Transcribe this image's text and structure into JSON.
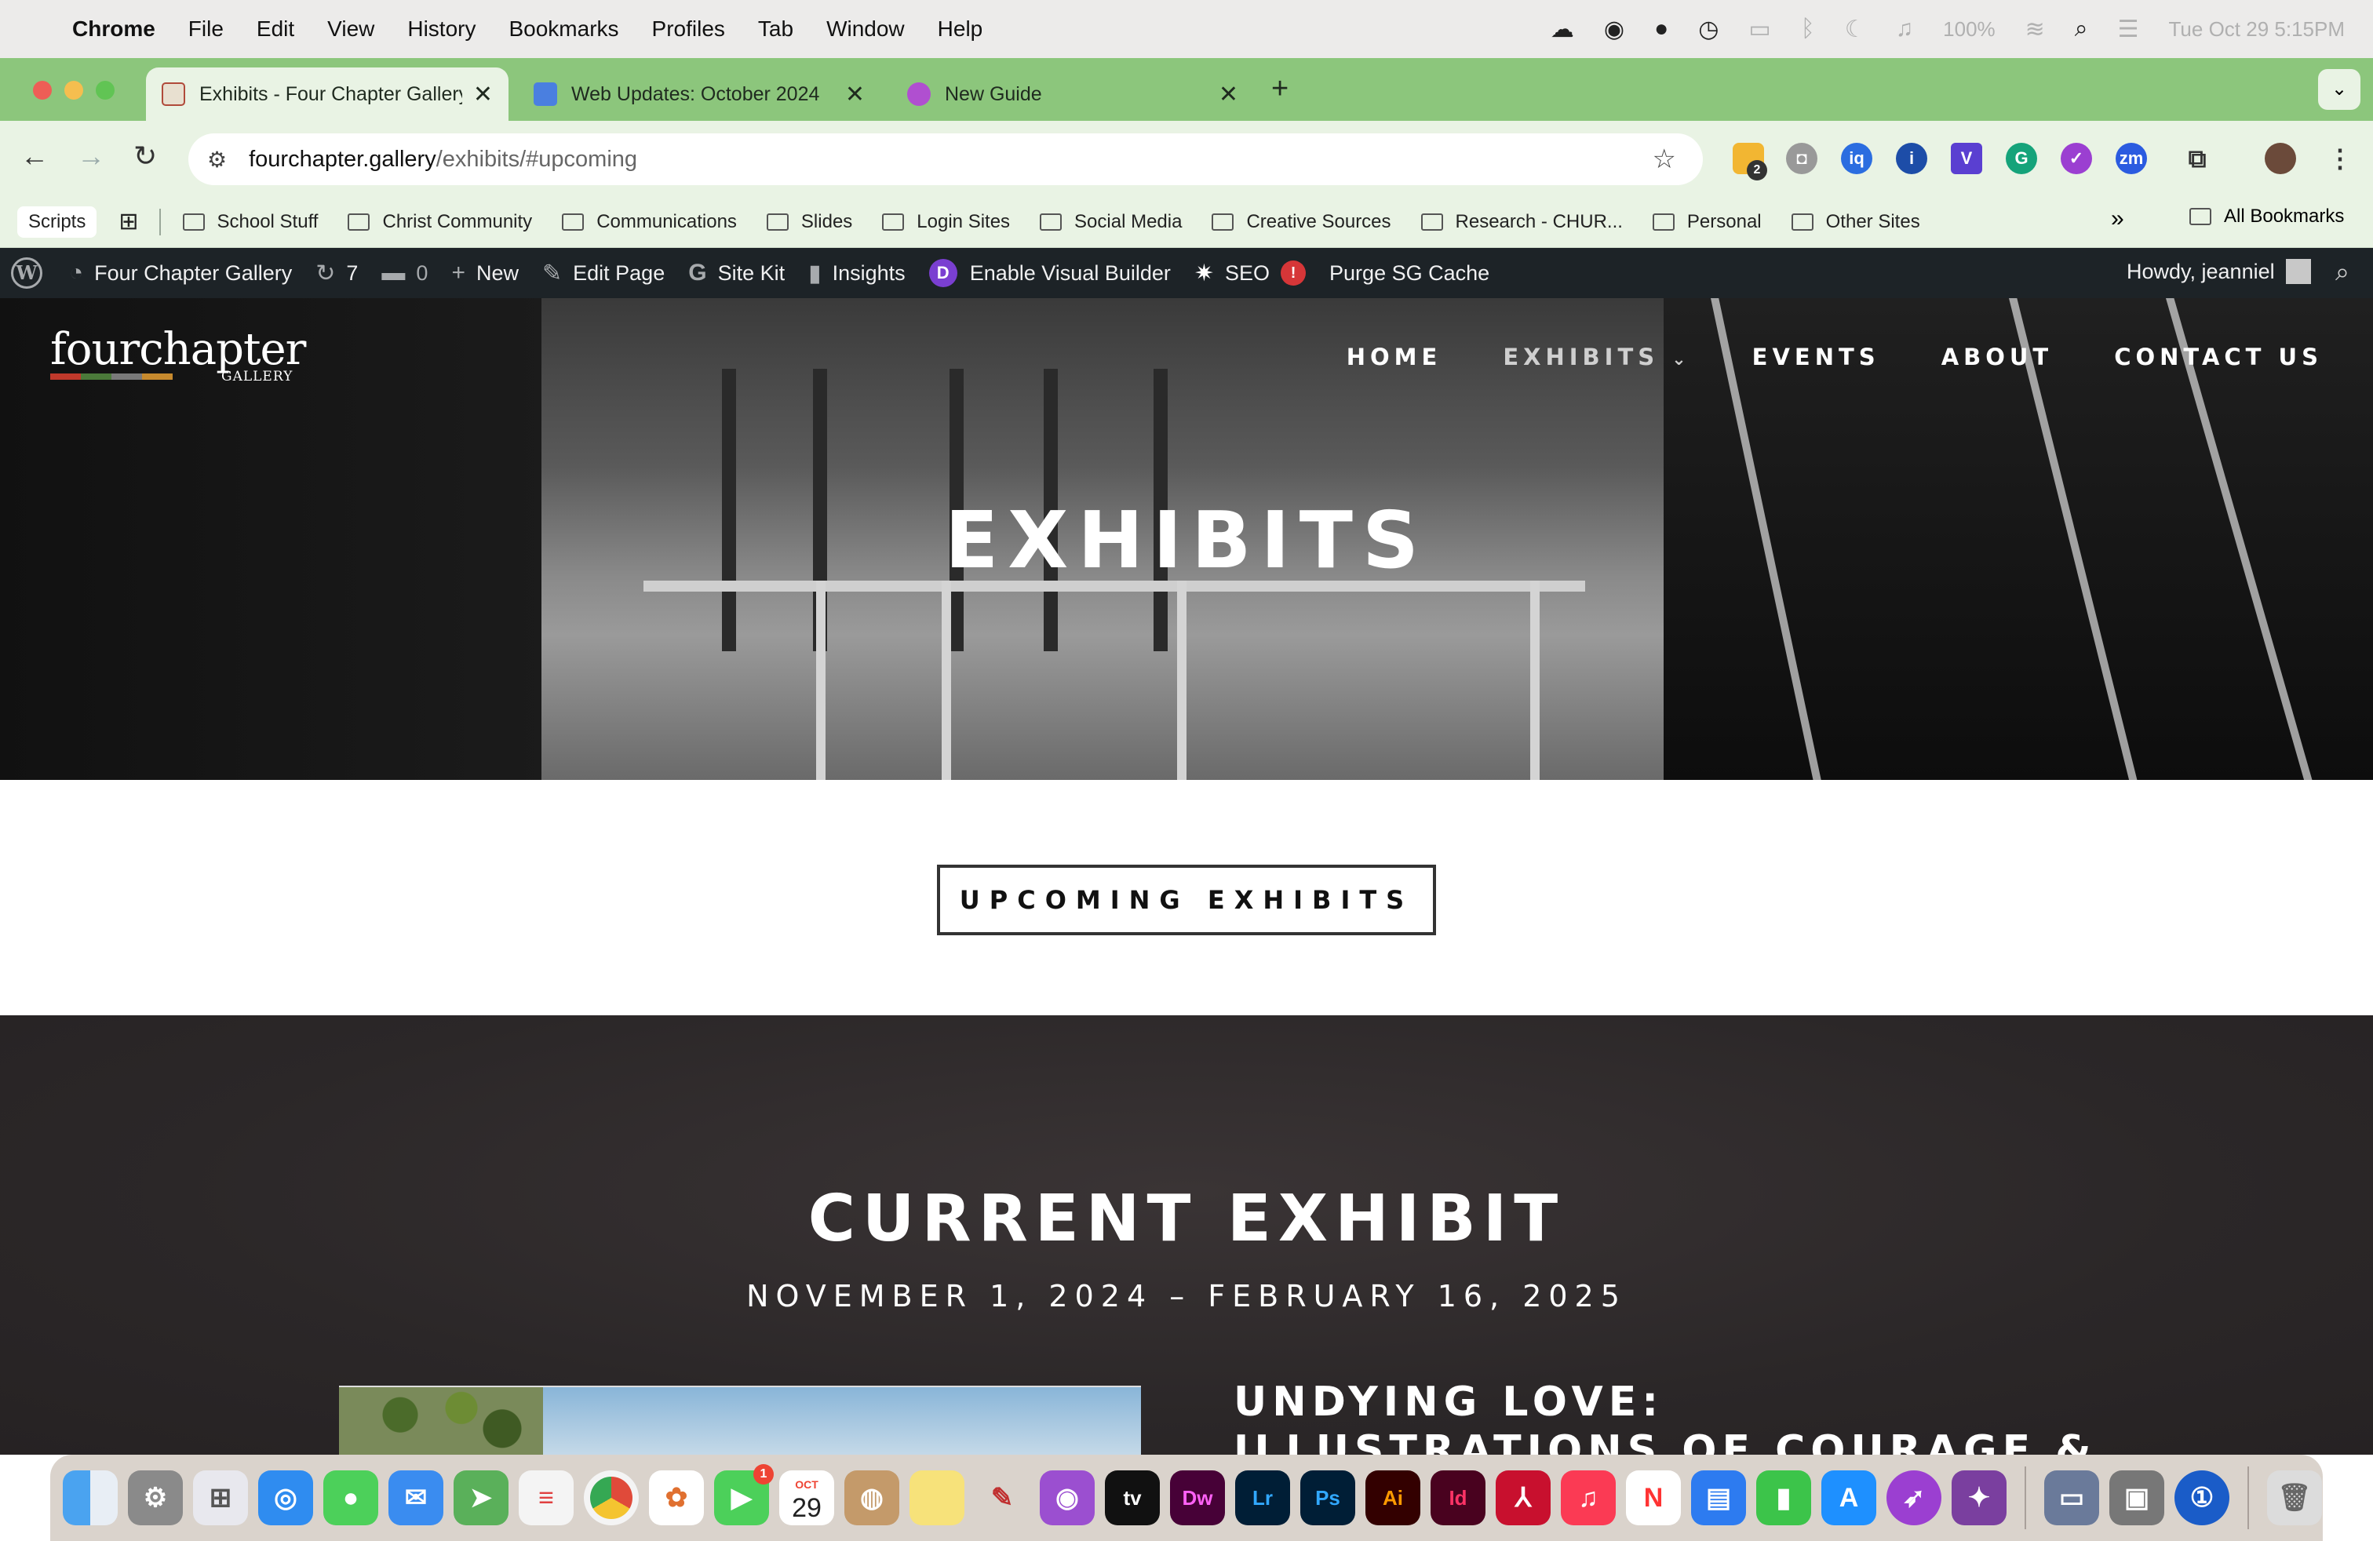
{
  "menubar": {
    "app": "Chrome",
    "items": [
      "File",
      "Edit",
      "View",
      "History",
      "Bookmarks",
      "Profiles",
      "Tab",
      "Window",
      "Help"
    ],
    "battery": "100%",
    "clock": "Tue Oct 29  5:15PM"
  },
  "tabs": [
    {
      "title": "Exhibits - Four Chapter Gallery",
      "active": true
    },
    {
      "title": "Web Updates: October 2024",
      "active": false
    },
    {
      "title": "New Guide",
      "active": false
    }
  ],
  "address": {
    "host": "fourchapter.gallery",
    "path": "/exhibits/#upcoming"
  },
  "extensions": {
    "badge": "2"
  },
  "bookmarks": {
    "scripts": "Scripts",
    "folders": [
      "School Stuff",
      "Christ Community",
      "Communications",
      "Slides",
      "Login Sites",
      "Social Media",
      "Creative Sources",
      "Research - CHUR...",
      "Personal",
      "Other Sites"
    ],
    "more": "»",
    "all": "All Bookmarks"
  },
  "wpbar": {
    "site": "Four Chapter Gallery",
    "updates": "7",
    "comments": "0",
    "new": "New",
    "edit": "Edit Page",
    "sitekit": "Site Kit",
    "insights": "Insights",
    "visual_builder": "Enable Visual Builder",
    "seo": "SEO",
    "seo_alert": "!",
    "purge": "Purge SG Cache",
    "howdy": "Howdy, jeanniel"
  },
  "site": {
    "logo": {
      "word1": "four",
      "word2": "chapter",
      "sub": "GALLERY"
    },
    "nav": [
      "HOME",
      "EXHIBITS",
      "EVENTS",
      "ABOUT",
      "CONTACT US"
    ],
    "hero_title": "EXHIBITS",
    "upcoming_button": "UPCOMING EXHIBITS",
    "current_title": "CURRENT EXHIBIT",
    "current_dates": "NOVEMBER 1, 2024 – FEBRUARY 16, 2025",
    "exhibit_line1": "UNDYING LOVE:",
    "exhibit_line2": "ILLUSTRATIONS OF COURAGE &"
  },
  "dock": {
    "calendar_month": "OCT",
    "calendar_day": "29",
    "messages_badge": "1"
  },
  "colors": {
    "tab_strip": "#8cc67c",
    "toolbar": "#e9f3e4",
    "wp_admin_bar": "#1d2327",
    "logo_stripe": [
      "#c0392b",
      "#4b7a3a",
      "#7a7a7a",
      "#c78a2e"
    ]
  }
}
